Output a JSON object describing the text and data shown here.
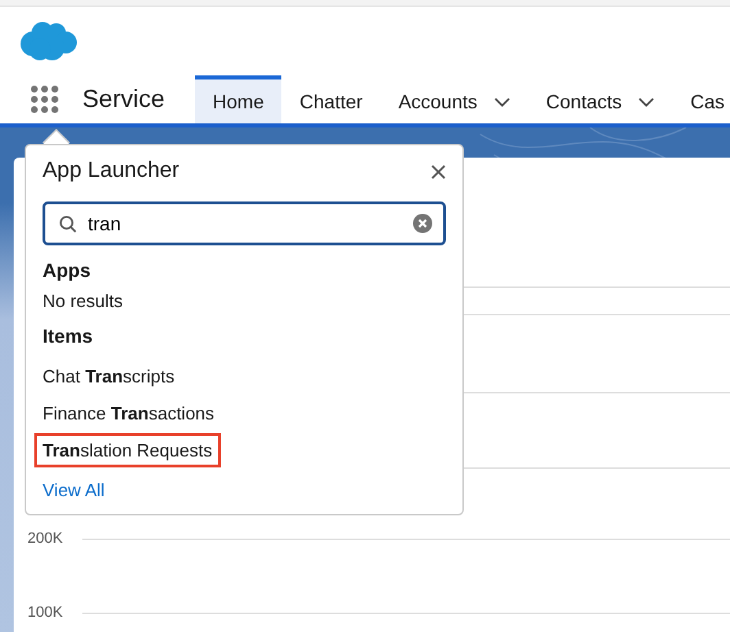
{
  "app_name": "Service",
  "nav_tabs": [
    {
      "label": "Home",
      "selected": true,
      "dropdown": false
    },
    {
      "label": "Chatter",
      "selected": false,
      "dropdown": false
    },
    {
      "label": "Accounts",
      "selected": false,
      "dropdown": true
    },
    {
      "label": "Contacts",
      "selected": false,
      "dropdown": true
    },
    {
      "label": "Cas",
      "selected": false,
      "dropdown": false
    }
  ],
  "app_launcher": {
    "title": "App Launcher",
    "search": {
      "value": "tran"
    },
    "sections": [
      {
        "heading": "Apps",
        "empty_text": "No results"
      },
      {
        "heading": "Items",
        "items": [
          {
            "label": "Chat **Tran**scripts",
            "highlighted": false
          },
          {
            "label": "Finance **Tran**sactions",
            "highlighted": false
          },
          {
            "label": "**Tran**slation Requests",
            "highlighted": true
          }
        ]
      }
    ],
    "view_all": "View All"
  },
  "chart": {
    "axis_labels": [
      "200K",
      "100K"
    ]
  }
}
